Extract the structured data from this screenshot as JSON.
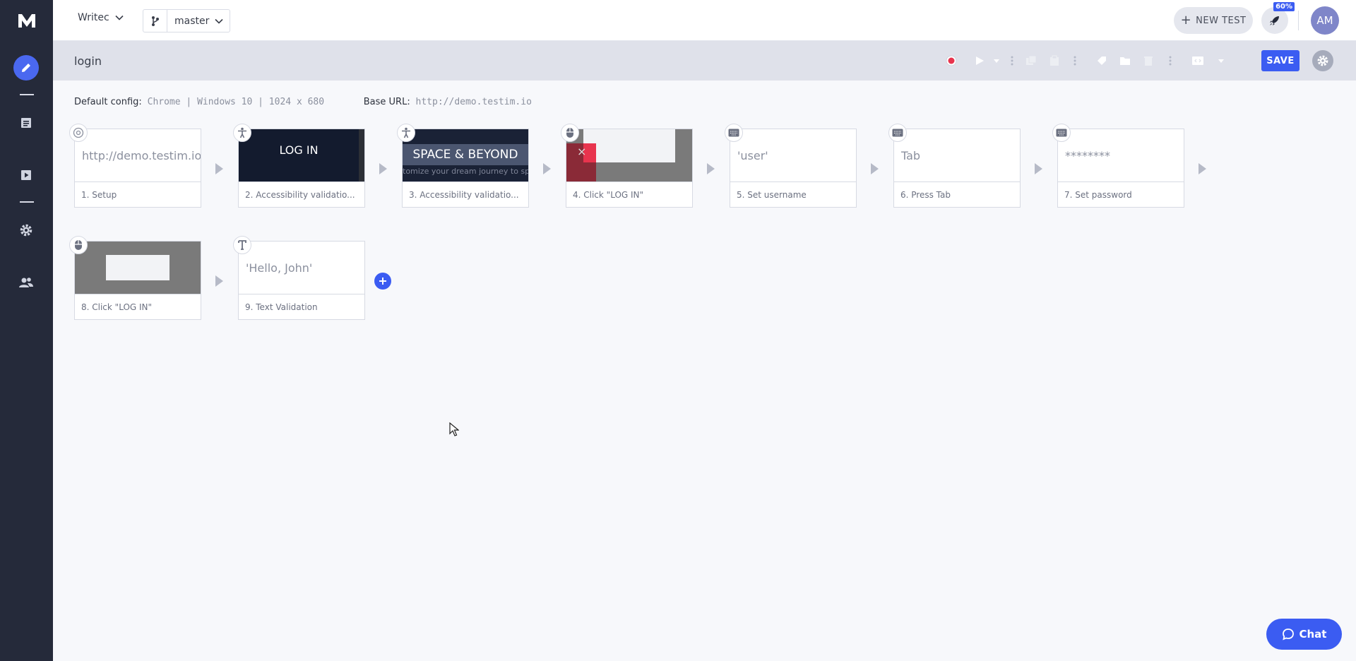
{
  "topbar": {
    "project": "Writec",
    "branch": "master",
    "new_test_label": "NEW TEST",
    "progress_badge": "60%",
    "avatar_initials": "AM"
  },
  "test": {
    "title": "login",
    "save_label": "SAVE"
  },
  "config": {
    "default_label": "Default config:",
    "default_value": "Chrome | Windows 10 | 1024 x 680",
    "base_url_label": "Base URL:",
    "base_url_value": "http://demo.testim.io"
  },
  "steps": [
    {
      "thumb": "http://demo.testim.io",
      "caption": "1. Setup",
      "icon": "chrome-icon"
    },
    {
      "thumb": "LOG IN",
      "caption": "2. Accessibility validatio...",
      "icon": "accessibility-icon"
    },
    {
      "thumb": "SPACE & BEYOND",
      "thumb_sub": "tomize your dream journey to sp",
      "caption": "3. Accessibility validatio...",
      "icon": "accessibility-icon"
    },
    {
      "thumb": "",
      "caption": "4. Click \"LOG IN\"",
      "icon": "mouse-icon"
    },
    {
      "thumb": "'user'",
      "caption": "5. Set username",
      "icon": "keyboard-icon"
    },
    {
      "thumb": "Tab",
      "caption": "6. Press Tab",
      "icon": "keyboard-icon"
    },
    {
      "thumb": "********",
      "caption": "7. Set password",
      "icon": "keyboard-icon"
    },
    {
      "thumb": "",
      "caption": "8. Click \"LOG IN\"",
      "icon": "mouse-icon"
    },
    {
      "thumb": "'Hello, John'",
      "caption": "9. Text Validation",
      "icon": "text-icon"
    }
  ],
  "chat_label": "Chat",
  "colors": {
    "accent": "#3b5cf2",
    "sidebar": "#252a3a",
    "record": "#e8344e"
  }
}
